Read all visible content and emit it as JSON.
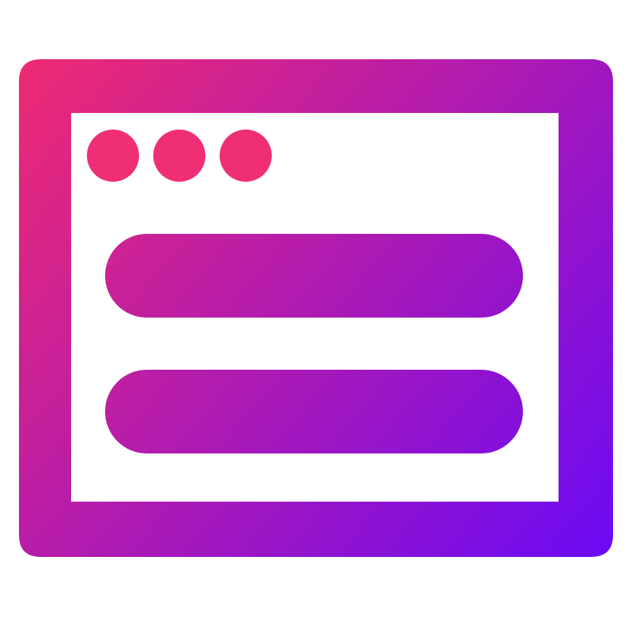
{
  "icon": {
    "name": "browser-window-icon",
    "gradient": {
      "start_color": "#ef2a72",
      "end_color": "#6a0af5",
      "direction": "top-left-to-bottom-right"
    },
    "window_dots": {
      "count": 3,
      "color": "#ef2e76"
    },
    "content_bars": 2
  }
}
